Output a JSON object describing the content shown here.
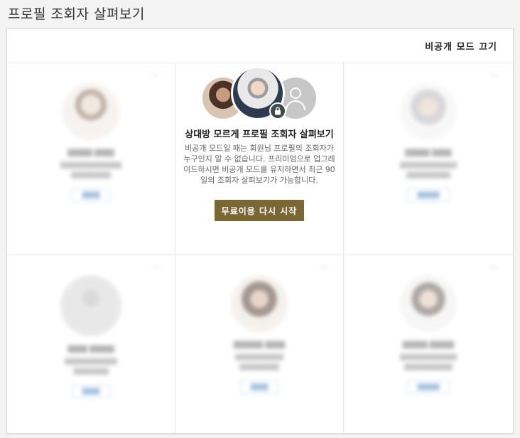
{
  "page": {
    "title": "프로필 조회자 살펴보기"
  },
  "header": {
    "toggle_label": "비공개 모드 끄기"
  },
  "feature": {
    "title": "상대방 모르게 프로필 조회자 살펴보기",
    "description": "비공개 모드일 때는 회원님 프로필의 조회자가 누구인지 알 수 없습니다. 프리미엄으로 업그레이드하시면 비공개 모드를 유지하면서 최근 90일의 조회자 살펴보기가 가능합니다.",
    "cta_label": "무료이용 다시 시작",
    "icons": [
      "viewer-photo",
      "viewer-photo",
      "generic-person-icon",
      "lock-icon"
    ],
    "colors": {
      "cta_bg": "#7a6733",
      "badge_bg": "#3f4a4d"
    }
  },
  "blurred_viewers": {
    "icons": [
      "viewer-photo",
      "viewer-photo",
      "generic-person-icon",
      "viewer-photo",
      "viewer-photo"
    ]
  }
}
